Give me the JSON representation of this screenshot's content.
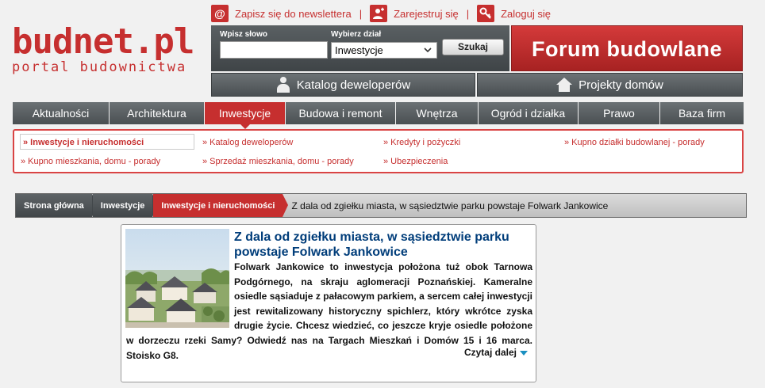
{
  "toplinks": {
    "newsletter": "Zapisz się do newslettera",
    "register": "Zarejestruj się",
    "login": "Zaloguj się",
    "separator": "|"
  },
  "logo": {
    "main": "budnet.pl",
    "sub": "portal budownictwa"
  },
  "search": {
    "query_label": "Wpisz słowo",
    "query_value": "",
    "section_label": "Wybierz dział",
    "section_selected": "Inwestycje",
    "submit_label": "Szukaj"
  },
  "forum_label": "Forum budowlane",
  "bar2": {
    "katalog": "Katalog deweloperów",
    "projekty": "Projekty domów"
  },
  "mainnav": [
    {
      "label": "Aktualności"
    },
    {
      "label": "Architektura"
    },
    {
      "label": "Inwestycje"
    },
    {
      "label": "Budowa i remont"
    },
    {
      "label": "Wnętrza"
    },
    {
      "label": "Ogród i działka"
    },
    {
      "label": "Prawo"
    },
    {
      "label": "Baza firm"
    }
  ],
  "subnav": [
    {
      "label": "» Inwestycje i nieruchomości"
    },
    {
      "label": "» Katalog deweloperów"
    },
    {
      "label": "» Kredyty i pożyczki"
    },
    {
      "label": "» Kupno działki budowlanej - porady"
    },
    {
      "label": "» Kupno mieszkania, domu - porady"
    },
    {
      "label": "» Sprzedaż mieszkania, domu - porady"
    },
    {
      "label": "» Ubezpieczenia"
    }
  ],
  "breadcrumb": {
    "home": "Strona główna",
    "section": "Inwestycje",
    "subsection": "Inwestycje i nieruchomości",
    "current": "Z dala od zgiełku miasta, w sąsiedztwie parku powstaje Folwark Jankowice"
  },
  "article": {
    "title": "Z dala od zgiełku miasta, w sąsiedztwie parku powstaje Folwark Jankowice",
    "body": "Folwark Jankowice to inwestycja położona tuż obok Tarnowa Podgórnego, na skraju aglomeracji Poznańskiej. Kameralne osiedle sąsiaduje z pałacowym parkiem, a sercem całej inwestycji jest rewitalizowany historyczny spichlerz, który wkrótce zyska drugie życie. Chcesz wiedzieć, co jeszcze kryje osiedle położone w dorzeczu rzeki Samy? Odwiedź nas na Targach Mieszkań i Domów 15 i 16 marca. Stoisko G8.",
    "read_more": "Czytaj dalej"
  },
  "colors": {
    "brand_red": "#c62f2f",
    "nav_gray": "#4a4f52",
    "title_blue": "#003d7a"
  }
}
